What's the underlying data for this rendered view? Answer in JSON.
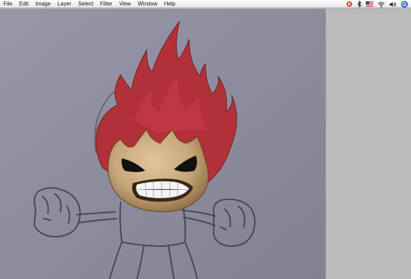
{
  "menubar": {
    "items": [
      {
        "label": "File"
      },
      {
        "label": "Edit"
      },
      {
        "label": "Image"
      },
      {
        "label": "Layer"
      },
      {
        "label": "Select"
      },
      {
        "label": "Filter"
      },
      {
        "label": "View"
      },
      {
        "label": "Window"
      },
      {
        "label": "Help"
      }
    ],
    "status_icons": [
      "script-icon",
      "bluetooth-icon",
      "us-flag-icon",
      "wifi-icon",
      "volume-icon",
      "spotlight-icon"
    ]
  },
  "colors": {
    "paper": "#8d8c9c",
    "flame_red": "#b23138",
    "face_tan": "#c7a679",
    "pencil": "#3a3a44",
    "workspace_gray": "#bcbcbc"
  }
}
